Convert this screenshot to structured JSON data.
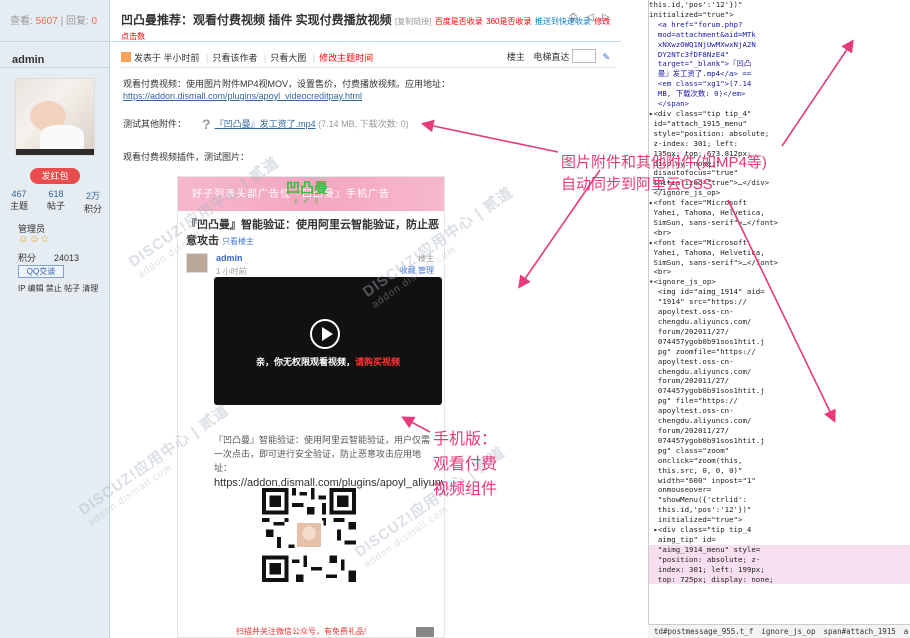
{
  "left": {
    "stats_views_label": "查看:",
    "stats_views": "5607",
    "stats_sep": "|",
    "stats_replies_label": "回复:",
    "stats_replies": "0",
    "username": "admin",
    "hongbao": "发红包",
    "counts": [
      {
        "value": "467",
        "label": "主题"
      },
      {
        "value": "618",
        "label": "帖子"
      },
      {
        "value": "2万",
        "label": "积分"
      }
    ],
    "group": "管理员",
    "stars": "☺☺☆",
    "points_label": "积分",
    "points_value": "24013",
    "qq": "QQ交谈",
    "ops": "IP 编辑 禁止 帖子 清理"
  },
  "thread": {
    "title": "凹凸曼推荐：观看付费视频 插件 实现付费播放视频",
    "copy_link": "[复制链接]",
    "baidu": "百度是否收录",
    "s360": "360是否收录",
    "push": "推送到快速收录",
    "edit": "修改",
    "click_count": "点击数",
    "meta_posted": "发表于 半小时前",
    "meta_author_only": "只看该作者",
    "meta_big": "只看大图",
    "meta_fix": "修改主题时间",
    "meta_floor": "楼主",
    "meta_goto": "电梯直达"
  },
  "post": {
    "intro": "观看付费视频：使用图片附件MP4视MOV，设置售价，付费播放视频。应用地址：",
    "intro_url": "https://addon.dismall.com/plugins/apoyl_videocreditpay.html",
    "attach_label": "测试其他附件：",
    "attach_file": "『凹凸曼』发工资了.mp4",
    "attach_info": "(7.14 MB, 下载次数: 0)",
    "pic_label": "观看付费视频插件，测试图片："
  },
  "phone": {
    "banner": "好子列表头部广告位『凹凸曼』手机广告",
    "logo": "凹凸曼",
    "logo_sub": "♀ ♂ ♀",
    "title": "『凹凸曼』智能验证：使用阿里云智能验证，防止恶意攻击",
    "only_op": "只看楼主",
    "user": "admin",
    "time": "1 小时前",
    "floor": "楼主",
    "actions": "收藏  管理",
    "video_text_a": "亲，你无权限观看视频，",
    "video_text_b": "请购买视频",
    "desc": "『凹凸曼』智能验证：使用阿里云智能验证，用户仅需一次点击，即可进行安全验证，防止恶意攻击应用地址：",
    "desc_url": "https://addon.dismall.com/plugins/apoyl_aliyunverify.html",
    "qr_caption": "扫描并关注微信公众号，有免费礼品!"
  },
  "watermark": {
    "line1": "DISCUZ!应用中心 | 贰道",
    "line2": "addon.dismall.com"
  },
  "annotations": {
    "a1_line1": "图片附件和其他附件(如MP4等)",
    "a1_line2": "自动同步到阿里云OSS",
    "a2_line1": "手机版：",
    "a2_line2": "观看付费",
    "a2_line3": "视频组件"
  },
  "devtools": {
    "lines": [
      "this.id,'pos':'12'})\"",
      "initialized=\"true\">",
      "  <a href=\"forum.php?",
      "  mod=attachment&aid=MTk",
      "  xNXwzOWQ1NjUwMXwxNjA2N",
      "  DY2NTc3fDF8NzE4\"",
      "  target=\"_blank\">『凹凸",
      "  曼』发工资了.mp4</a> ==",
      "  <em class=\"xg1\">(7.14",
      "  MB, 下载次数: 0)</em>",
      "  </span>",
      "▸<div class=\"tip tip_4\"",
      " id=\"attach_1915_menu\"",
      " style=\"position: absolute;",
      " z-index: 301; left:",
      " 135px; top: 673.812px;",
      " display: none;\"",
      " disautofocus=\"true\"",
      " initialized=\"true\">…</div>",
      " </ignore_js_op>",
      "▸<font face=\"Microsoft",
      " Yahei, Tahoma, Helvetica,",
      " SimSun, sans-serif\">…</font>",
      " <br>",
      "▸<font face=\"Microsoft",
      " Yahei, Tahoma, Helvetica,",
      " SimSun, sans-serif\">…</font>",
      " <br>",
      "▾<ignore_js_op>",
      "  <img id=\"aimg_1914\" aid=",
      "  \"1914\" src=\"https://",
      "  apoyltest.oss-cn-",
      "  chengdu.aliyuncs.com/",
      "  forum/202011/27/",
      "  074457ygob0b91sos1htit.j",
      "  pg\" zoomfile=\"https://",
      "  apoyltest.oss-cn-",
      "  chengdu.aliyuncs.com/",
      "  forum/202011/27/",
      "  074457ygob0b91sos1htit.j",
      "  pg\" file=\"https://",
      "  apoyltest.oss-cn-",
      "  chengdu.aliyuncs.com/",
      "  forum/202011/27/",
      "  074457ygob0b91sos1htit.j",
      "  pg\" class=\"zoom\"",
      "  onclick=\"zoom(this,",
      "  this.src, 0, 0, 0)\"",
      "  width=\"600\" inpost=\"1\"",
      "  onmouseover=",
      "  \"showMenu({'ctrlid':",
      "  this.id,'pos':'12'})\"",
      "  initialized=\"true\">",
      " ▸<div class=\"tip tip_4",
      "  aimg_tip\" id=",
      "  \"aimg_1914_menu\" style=",
      "  \"position: absolute; z-",
      "  index: 301; left: 199px;",
      "  top: 725px; display: none;"
    ],
    "crumbs": [
      "td#postmessage_955.t_f",
      "ignore_js_op",
      "span#attach_1915",
      "a"
    ]
  },
  "colors": {
    "sidebar_bg": "#E5EDF2",
    "annotation": "#e63a7a",
    "link": "#336699",
    "red": "#ff0000"
  }
}
